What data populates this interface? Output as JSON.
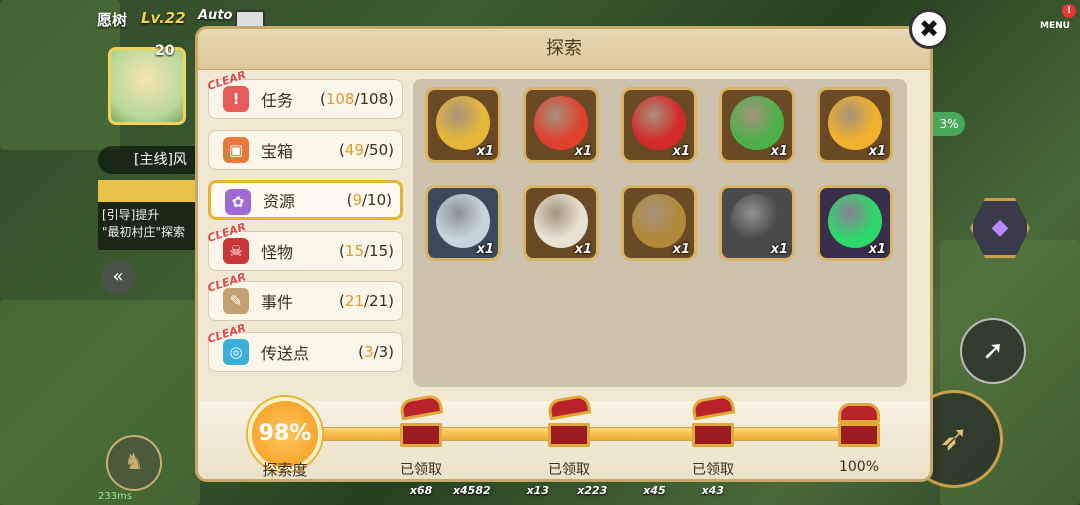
{
  "hud": {
    "player_name": "愿树",
    "level": "Lv.22",
    "auto_label": "Auto",
    "portrait_level": "20",
    "main_quest": "[主线]风",
    "quest_hint": "[引导]提升",
    "quest_hint2": "\"最初村庄\"探索",
    "ping": "233ms",
    "menu_label": "MENU",
    "menu_alert": "!",
    "side_pct": "3%"
  },
  "hotbar": [
    "x68",
    "x4582",
    "x13",
    "x223",
    "x45",
    "x43"
  ],
  "dialog": {
    "title": "探索",
    "close_label": "✖",
    "categories": [
      {
        "label": "任务",
        "current": "108",
        "total": "/108)",
        "open": "(",
        "clear": true,
        "icon": "!",
        "color": "#e65a5a",
        "icon_name": "quest-icon"
      },
      {
        "label": "宝箱",
        "current": "49",
        "total": "/50)",
        "open": "(",
        "clear": false,
        "icon": "▣",
        "color": "#ea7a3c",
        "icon_name": "chest-icon"
      },
      {
        "label": "资源",
        "current": "9",
        "total": "/10)",
        "open": "(",
        "clear": false,
        "icon": "✿",
        "color": "#a069d6",
        "icon_name": "resource-icon"
      },
      {
        "label": "怪物",
        "current": "15",
        "total": "/15)",
        "open": "(",
        "clear": true,
        "icon": "☠",
        "color": "#c93636",
        "icon_name": "monster-icon"
      },
      {
        "label": "事件",
        "current": "21",
        "total": "/21)",
        "open": "(",
        "clear": true,
        "icon": "✎",
        "color": "#c4a070",
        "icon_name": "event-icon"
      },
      {
        "label": "传送点",
        "current": "3",
        "total": "/3)",
        "open": "(",
        "clear": true,
        "icon": "◎",
        "color": "#3ab0d8",
        "icon_name": "teleport-icon"
      }
    ],
    "clear_label": "CLEAR",
    "items": [
      {
        "name": "wheat",
        "qty": "x1",
        "bg": "#6a4a24",
        "art": "#e6b83a"
      },
      {
        "name": "tomato",
        "qty": "x1",
        "bg": "#6a4a24",
        "art": "#e0412e"
      },
      {
        "name": "mushroom",
        "qty": "x1",
        "bg": "#6a4a24",
        "art": "#d42a2a"
      },
      {
        "name": "herb",
        "qty": "x1",
        "bg": "#6a4a24",
        "art": "#4fb04a"
      },
      {
        "name": "honeycomb",
        "qty": "x1",
        "bg": "#6a4a24",
        "art": "#f2b12c"
      },
      {
        "name": "spider-web",
        "qty": "x1",
        "bg": "#3a4a5a",
        "art": "#c8d4dc"
      },
      {
        "name": "egg",
        "qty": "x1",
        "bg": "#6a4a24",
        "art": "#e8e2d4"
      },
      {
        "name": "ore",
        "qty": "x1",
        "bg": "#6a4a24",
        "art": "#b08a3a"
      },
      {
        "name": "stone",
        "qty": "x1",
        "bg": "#4a4a4a",
        "art": "#4a4a4a"
      },
      {
        "name": "crystal",
        "qty": "x1",
        "bg": "#3a2f4a",
        "art": "#2ed86a"
      }
    ],
    "progress": {
      "percent_label": "98%",
      "percent": 98,
      "label": "探索度",
      "rewards": [
        {
          "label": "已领取",
          "opened": true
        },
        {
          "label": "已领取",
          "opened": true
        },
        {
          "label": "已领取",
          "opened": true
        },
        {
          "label": "100%",
          "opened": false
        }
      ]
    }
  }
}
